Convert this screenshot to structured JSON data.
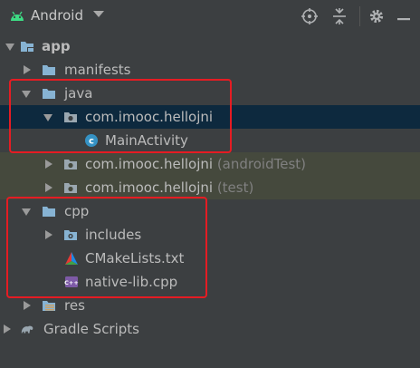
{
  "toolbar": {
    "view_label": "Android",
    "icons": [
      "android-icon",
      "target-icon",
      "collapse-icon",
      "gear-icon",
      "minimize-icon"
    ]
  },
  "tree": {
    "app": "app",
    "manifests": "manifests",
    "java": "java",
    "pkg_main": "com.imooc.hellojni",
    "main_activity": "MainActivity",
    "pkg_android_test": "com.imooc.hellojni",
    "pkg_android_test_suffix": "(androidTest)",
    "pkg_test": "com.imooc.hellojni",
    "pkg_test_suffix": "(test)",
    "cpp": "cpp",
    "includes": "includes",
    "cmake": "CMakeLists.txt",
    "native_lib": "native-lib.cpp",
    "res": "res",
    "gradle": "Gradle Scripts"
  },
  "colors": {
    "background": "#3c3f41",
    "selection": "#0d293e",
    "test_highlight": "#45493d",
    "annotation_box": "#e51c23",
    "folder": "#87b3d3"
  }
}
